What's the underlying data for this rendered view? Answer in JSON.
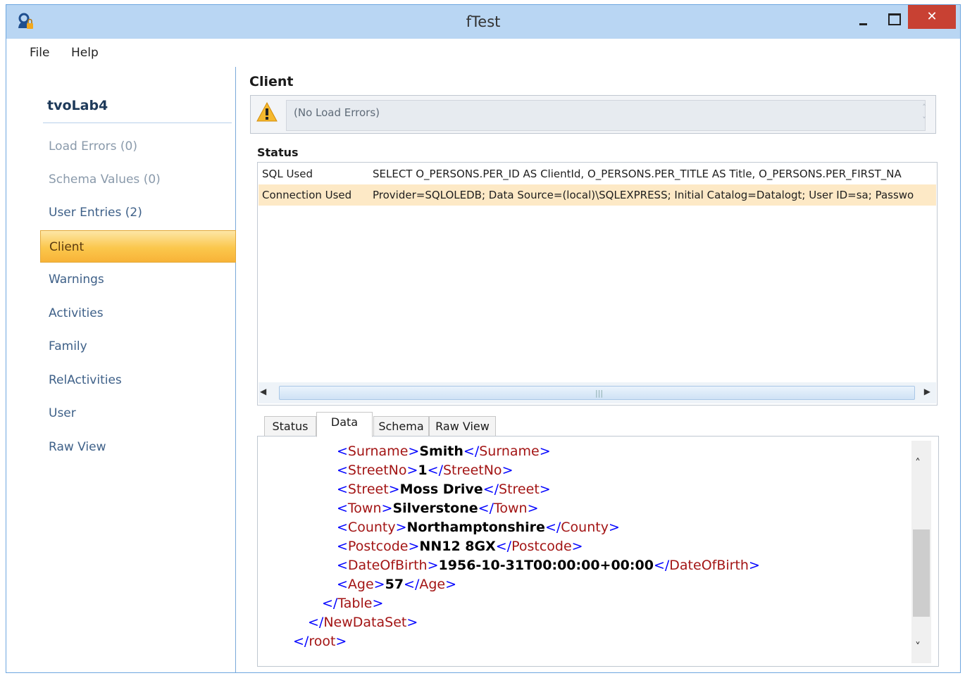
{
  "window": {
    "title": "fTest"
  },
  "menu": {
    "items": [
      "File",
      "Help"
    ]
  },
  "sidebar": {
    "title": "tvoLab4",
    "items": [
      {
        "label": "Load Errors (0)",
        "state": "muted"
      },
      {
        "label": "Schema Values (0)",
        "state": "muted"
      },
      {
        "label": "User Entries (2)",
        "state": "normal"
      },
      {
        "label": "Client",
        "state": "active"
      },
      {
        "label": "Warnings",
        "state": "normal"
      },
      {
        "label": "Activities",
        "state": "normal"
      },
      {
        "label": "Family",
        "state": "normal"
      },
      {
        "label": "RelActivities",
        "state": "normal"
      },
      {
        "label": "User",
        "state": "normal"
      },
      {
        "label": "Raw View",
        "state": "normal"
      }
    ]
  },
  "main": {
    "title": "Client",
    "load_errors_text": "(No Load Errors)",
    "status_label": "Status",
    "status_rows": [
      {
        "key": "SQL Used",
        "value": "SELECT O_PERSONS.PER_ID AS ClientId, O_PERSONS.PER_TITLE AS Title, O_PERSONS.PER_FIRST_NA",
        "selected": false
      },
      {
        "key": "Connection Used",
        "value": "Provider=SQLOLEDB; Data Source=(local)\\SQLEXPRESS; Initial Catalog=Datalogt; User ID=sa; Passwo",
        "selected": true
      }
    ],
    "tabs": [
      "Status",
      "Data",
      "Schema",
      "Raw View"
    ],
    "active_tab": "Data",
    "xml_lines": [
      {
        "indent": 1,
        "kind": "element",
        "tag": "Surname",
        "value": "Smith"
      },
      {
        "indent": 1,
        "kind": "element",
        "tag": "StreetNo",
        "value": "1"
      },
      {
        "indent": 1,
        "kind": "element",
        "tag": "Street",
        "value": "Moss Drive"
      },
      {
        "indent": 1,
        "kind": "element",
        "tag": "Town",
        "value": "Silverstone"
      },
      {
        "indent": 1,
        "kind": "element",
        "tag": "County",
        "value": "Northamptonshire"
      },
      {
        "indent": 1,
        "kind": "element",
        "tag": "Postcode",
        "value": "NN12 8GX"
      },
      {
        "indent": 1,
        "kind": "element",
        "tag": "DateOfBirth",
        "value": "1956-10-31T00:00:00+00:00"
      },
      {
        "indent": 1,
        "kind": "element",
        "tag": "Age",
        "value": "57"
      },
      {
        "indent": 2,
        "kind": "close",
        "tag": "Table"
      },
      {
        "indent": 3,
        "kind": "close",
        "tag": "NewDataSet"
      },
      {
        "indent": 4,
        "kind": "close",
        "tag": "root"
      }
    ]
  },
  "colors": {
    "xml_tag": "#a31515",
    "xml_bracket": "#0000ff",
    "active_nav": "#fbc74c",
    "selected_row": "#fde9c6",
    "titlebar": "#b9d6f3",
    "close_button": "#c84133"
  },
  "icons": {
    "app": "user-lock-icon",
    "warning": "warning-triangle-icon"
  }
}
